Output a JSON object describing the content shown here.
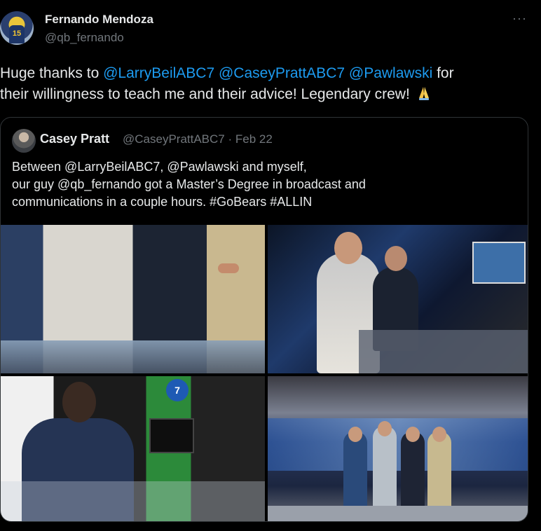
{
  "author": {
    "name": "Fernando Mendoza",
    "handle": "@qb_fernando",
    "avatar_jersey": "15"
  },
  "more_icon": "···",
  "tweet": {
    "prefix": "Huge thanks to ",
    "mention1": "@LarryBeilABC7",
    "mention2": "@CaseyPrattABC7",
    "mention3": "@Pawlawski",
    "line1_suffix": " for",
    "line2": "their willingness to teach me and their advice! Legendary crew!",
    "emoji": "folded-hands"
  },
  "quote": {
    "name": "Casey Pratt",
    "handle_date": "@CaseyPrattABC7 · Feb 22",
    "lines": [
      "Between @LarryBeilABC7, @Pawlawski and myself,",
      "our guy @qb_fernando got a Master’s Degree in broadcast and",
      "communications in a couple hours. #GoBears #ALLIN"
    ],
    "photo_logo": "7"
  },
  "colors": {
    "background": "#000000",
    "text": "#e7e9ea",
    "muted": "#71767b",
    "link": "#1d9bf0",
    "border": "#2f3336"
  }
}
